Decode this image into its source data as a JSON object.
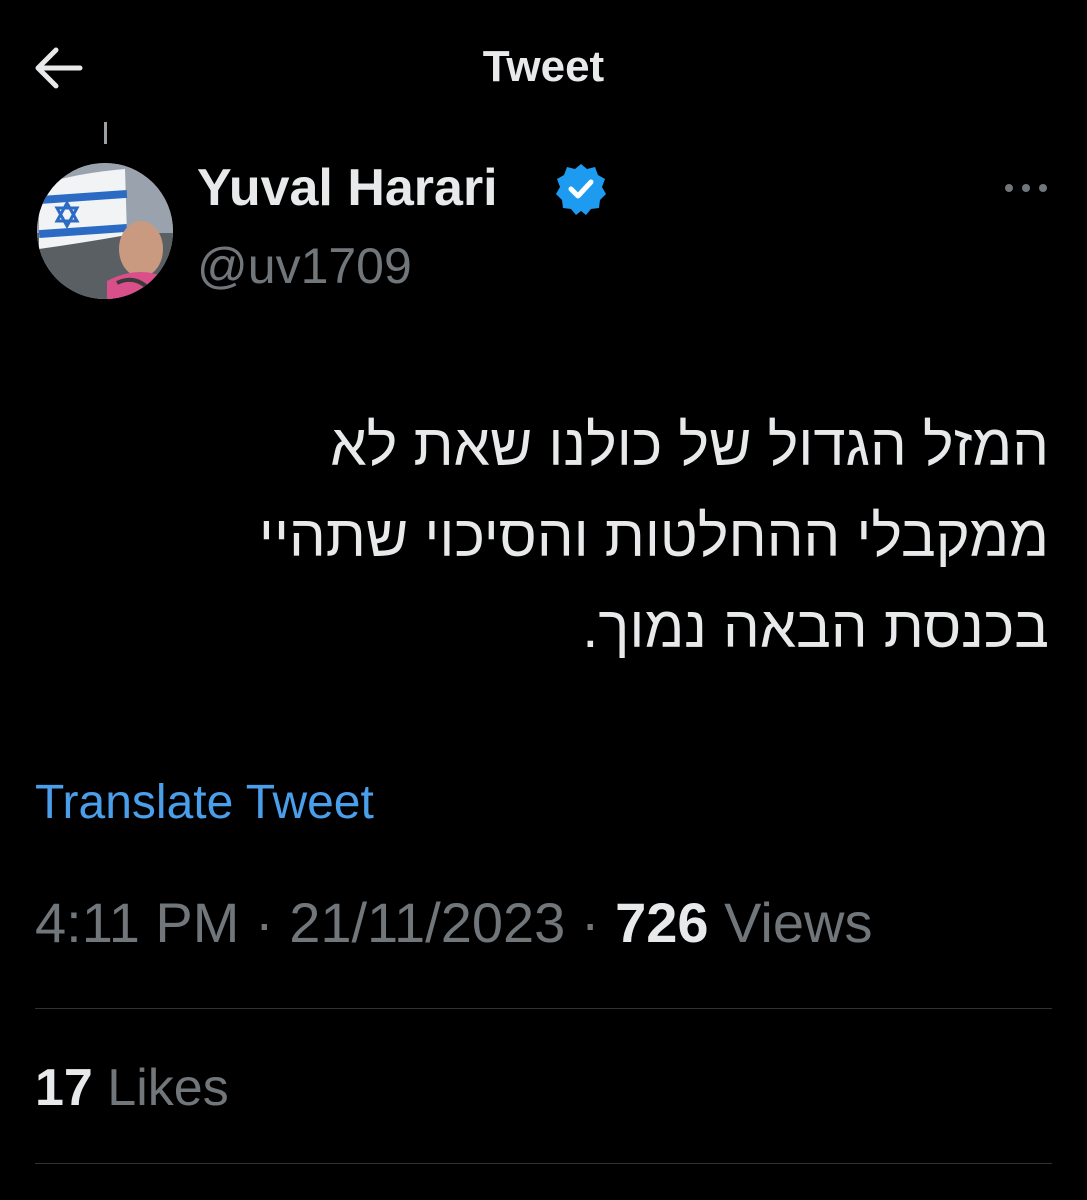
{
  "header": {
    "title": "Tweet",
    "back_icon": "arrow-left-icon"
  },
  "author": {
    "display_name": "Yuval Harari",
    "handle": "@uv1709",
    "verified_icon": "verified-badge-icon",
    "verified_color": "#1d9bf0"
  },
  "tweet": {
    "lines": [
      "המזל הגדול של כולנו שאת לא",
      "ממקבלי ההחלטות והסיכוי שתהיי",
      "בכנסת הבאה נמוך."
    ],
    "translate_label": "Translate Tweet",
    "time": "4:11 PM",
    "date": "21/11/2023",
    "separator": "·",
    "views_count": "726",
    "views_label": "Views"
  },
  "stats": {
    "likes_count": "17",
    "likes_label": "Likes"
  },
  "colors": {
    "background": "#000000",
    "primary_text": "#e7e9ea",
    "secondary_text": "#71767b",
    "link": "#4a9eea",
    "divider": "#2f3336"
  }
}
